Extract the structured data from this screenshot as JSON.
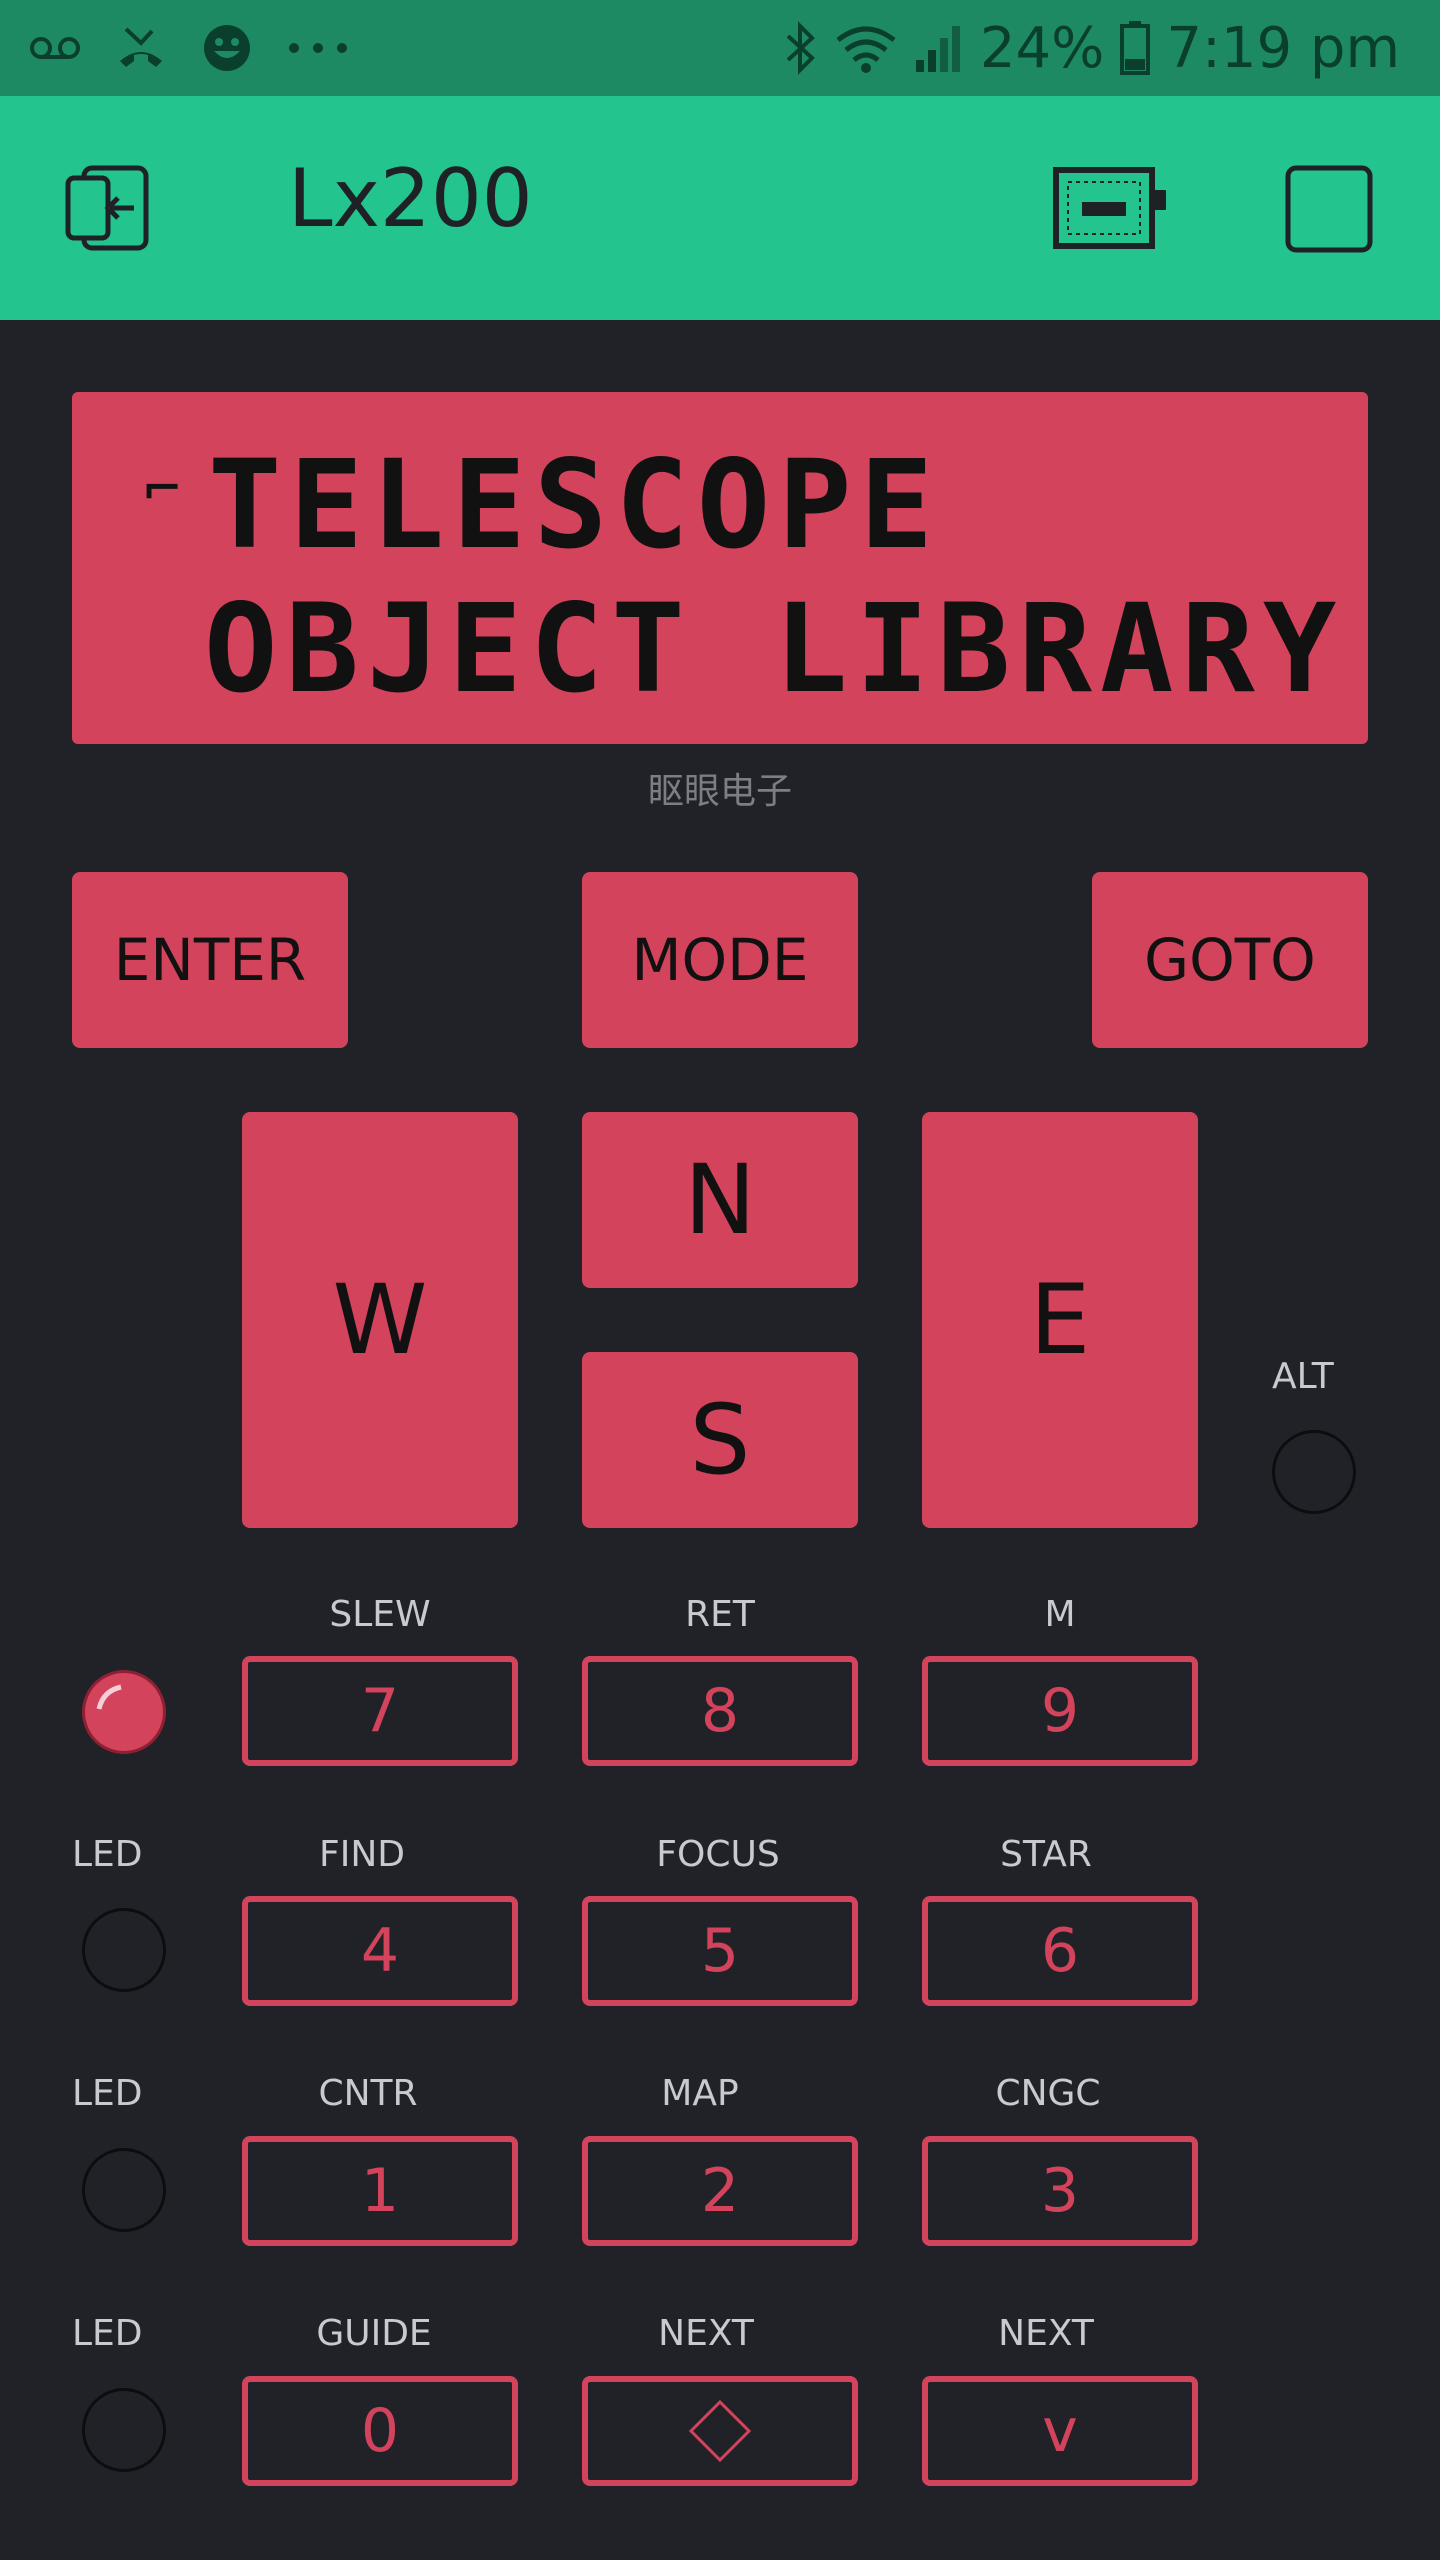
{
  "status_bar": {
    "icons": [
      "voicemail-icon",
      "missed-call-icon",
      "emoji-icon",
      "more-icon",
      "bluetooth-icon",
      "wifi-icon",
      "signal-icon"
    ],
    "battery": "24%",
    "time": "7:19 pm"
  },
  "app_bar": {
    "title": "Lx200",
    "back_icon": "exit-project-icon",
    "device_icon": "device-battery-icon",
    "square_icon": "stop-icon"
  },
  "lcd": {
    "caret": "⌐",
    "line1": "TELESCOPE",
    "line2": "OBJECT LIBRARY"
  },
  "subtitle": "眍眼电子",
  "buttons": {
    "enter": "ENTER",
    "mode": "MODE",
    "goto": "GOTO",
    "west": "W",
    "north": "N",
    "south": "S",
    "east": "E"
  },
  "alt_label": "ALT",
  "keypad": [
    {
      "labels": [
        "SLEW",
        "RET",
        "M"
      ],
      "keys": [
        "7",
        "8",
        "9"
      ],
      "led_label": "",
      "led_on": true
    },
    {
      "labels": [
        "FIND",
        "FOCUS",
        "STAR"
      ],
      "keys": [
        "4",
        "5",
        "6"
      ],
      "led_label": "LED",
      "led_on": false
    },
    {
      "labels": [
        "CNTR",
        "MAP",
        "CNGC"
      ],
      "keys": [
        "1",
        "2",
        "3"
      ],
      "led_label": "LED",
      "led_on": false
    },
    {
      "labels": [
        "GUIDE",
        "NEXT",
        "NEXT"
      ],
      "keys": [
        "0",
        "◇",
        "v"
      ],
      "led_label": "LED",
      "led_on": false
    }
  ],
  "colors": {
    "accent": "#d3435c",
    "app_bar": "#23c48e",
    "status_bar": "#1e8a64",
    "background": "#212228"
  }
}
